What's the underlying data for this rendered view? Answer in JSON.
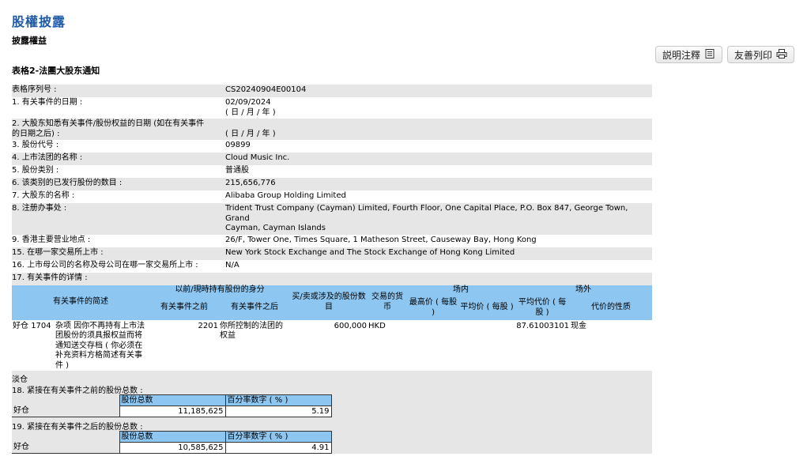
{
  "header": {
    "title": "股權披露",
    "subtitle": "披露權益",
    "form_name": "表格2-法團大股东通知",
    "buttons": {
      "notes": "説明注釋",
      "print": "友善列印"
    }
  },
  "fields": [
    {
      "label": "表格序列号 :",
      "value": "CS20240904E00104",
      "shade": true
    },
    {
      "label": "1. 有关事件的日期 :",
      "value": "02/09/2024",
      "value2": "( 日 / 月 / 年 )",
      "shade": false
    },
    {
      "label": "2. 大股东知悉有关事件/股份权益的日期 (如在有关事件",
      "label2": "的日期之后) :",
      "value": "",
      "value2": "( 日 / 月 / 年 )",
      "shade": true
    },
    {
      "label": "3. 股份代号 :",
      "value": "09899",
      "shade": false
    },
    {
      "label": "4. 上市法团的名称 :",
      "value": "Cloud Music Inc.",
      "shade": true
    },
    {
      "label": "5. 股份类别 :",
      "value": "普通股",
      "shade": false
    },
    {
      "label": "6. 该类别的已发行股份的数目 :",
      "value": "215,656,776",
      "shade": true
    },
    {
      "label": "7. 大股东的名称 :",
      "value": "Alibaba Group Holding Limited",
      "shade": false
    },
    {
      "label": "8. 注册办事处 :",
      "value": "Trident Trust Company (Cayman) Limited, Fourth Floor, One Capital Place, P.O. Box 847, George Town, Grand",
      "value2": "Cayman, Cayman Islands",
      "shade": true
    },
    {
      "label": "9. 香港主要营业地点 :",
      "value": "26/F, Tower One, Times Square, 1 Matheson Street, Causeway Bay, Hong Kong",
      "shade": false
    },
    {
      "label": "15. 在哪一家交易所上市 :",
      "value": "New York Stock Exchange and The Stock Exchange of Hong Kong Limited",
      "shade": true
    },
    {
      "label": "16. 上市母公司的名称及母公司在哪一家交易所上市 :",
      "value": "N/A",
      "shade": false
    },
    {
      "label": "17. 有关事件的详情 :",
      "value": "",
      "shade": true
    }
  ],
  "event_table": {
    "headers": {
      "desc": "有关事件的简述",
      "capacity": "以前/現時持有股份的身分",
      "before": "有关事件之前",
      "after": "有关事件之后",
      "shares": "买/卖或涉及的股份数目",
      "currency": "交易的货币",
      "onex": "场内",
      "offex": "场外",
      "high": "最高价 ( 每股 )",
      "avg": "平均价 ( 每股 )",
      "avgoff": "平均代价 ( 每股 )",
      "nature": "代价的性质"
    },
    "row": {
      "position": "好仓",
      "code_before": "1704",
      "desc": "杂项 因你不再持有上市法团股份的须具报权益而将通知送交存档 ( 你必须在补充资料方格简述有关事件 )",
      "code_after": "2201",
      "capacity": "你所控制的法团的权益",
      "shares": "600,000",
      "currency": "HKD",
      "avg_off": "87.61003101",
      "nature": "现金"
    },
    "short_label": "淡仓"
  },
  "section18": {
    "label": "18. 紧接在有关事件之前的股份总数 :",
    "col1": "股份总数",
    "col2": "百分率数字 ( % )",
    "row_label": "好仓",
    "shares": "11,185,625",
    "pct": "5.19"
  },
  "section19": {
    "label": "19. 紧接在有关事件之后的股份总数 :",
    "col1": "股份总数",
    "col2": "百分率数字 ( % )",
    "row_label": "好仓",
    "shares": "10,585,625",
    "pct": "4.91"
  },
  "icons": {
    "notes": "notes-icon",
    "print": "printer-icon"
  },
  "colors": {
    "title": "#1f5aa6",
    "table_header": "#8ec6f2",
    "shade": "#e6e6e6"
  }
}
